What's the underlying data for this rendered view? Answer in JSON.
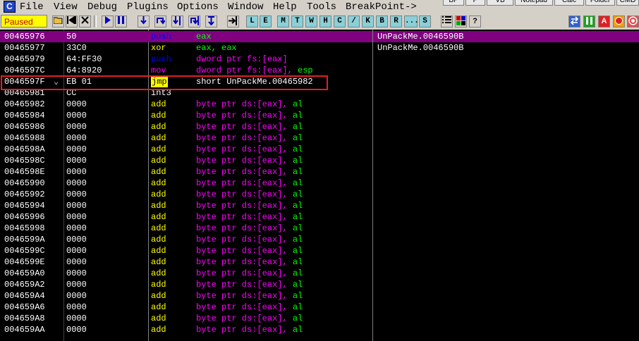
{
  "app": {
    "icon": "C"
  },
  "menu": [
    "File",
    "View",
    "Debug",
    "Plugins",
    "Options",
    "Window",
    "Help",
    "Tools",
    "BreakPoint->"
  ],
  "right_tabs": [
    "BP",
    "P",
    "VB",
    "Notepad",
    "Calc",
    "Folder",
    "CMD"
  ],
  "toolbar": {
    "status": "Paused",
    "letters": [
      "L",
      "E",
      "M",
      "T",
      "W",
      "H",
      "C",
      "/",
      "K",
      "B",
      "R",
      "...",
      "S"
    ]
  },
  "rows": [
    {
      "addr": "00465976",
      "bytes": "50",
      "mark": "",
      "mnem": "push",
      "ops": "eax"
    },
    {
      "addr": "00465977",
      "bytes": "33C0",
      "mark": "",
      "mnem": "xor",
      "ops": "eax, eax"
    },
    {
      "addr": "00465979",
      "bytes": "64:FF30",
      "mark": "",
      "mnem": "push",
      "ops": "dword ptr fs:[eax]"
    },
    {
      "addr": "0046597C",
      "bytes": "64:8920",
      "mark": "",
      "mnem": "mov",
      "ops": "dword ptr fs:[eax], esp"
    },
    {
      "addr": "0046597F",
      "bytes": "EB 01",
      "mark": "⌄",
      "mnem": "jmp",
      "ops": "short UnPackMe.00465982"
    },
    {
      "addr": "00465981",
      "bytes": "CC",
      "mark": "",
      "mnem": "int3",
      "ops": ""
    },
    {
      "addr": "00465982",
      "bytes": "0000",
      "mark": "",
      "mnem": "add",
      "ops": "byte ptr ds:[eax], al"
    },
    {
      "addr": "00465984",
      "bytes": "0000",
      "mark": "",
      "mnem": "add",
      "ops": "byte ptr ds:[eax], al"
    },
    {
      "addr": "00465986",
      "bytes": "0000",
      "mark": "",
      "mnem": "add",
      "ops": "byte ptr ds:[eax], al"
    },
    {
      "addr": "00465988",
      "bytes": "0000",
      "mark": "",
      "mnem": "add",
      "ops": "byte ptr ds:[eax], al"
    },
    {
      "addr": "0046598A",
      "bytes": "0000",
      "mark": "",
      "mnem": "add",
      "ops": "byte ptr ds:[eax], al"
    },
    {
      "addr": "0046598C",
      "bytes": "0000",
      "mark": "",
      "mnem": "add",
      "ops": "byte ptr ds:[eax], al"
    },
    {
      "addr": "0046598E",
      "bytes": "0000",
      "mark": "",
      "mnem": "add",
      "ops": "byte ptr ds:[eax], al"
    },
    {
      "addr": "00465990",
      "bytes": "0000",
      "mark": "",
      "mnem": "add",
      "ops": "byte ptr ds:[eax], al"
    },
    {
      "addr": "00465992",
      "bytes": "0000",
      "mark": "",
      "mnem": "add",
      "ops": "byte ptr ds:[eax], al"
    },
    {
      "addr": "00465994",
      "bytes": "0000",
      "mark": "",
      "mnem": "add",
      "ops": "byte ptr ds:[eax], al"
    },
    {
      "addr": "00465996",
      "bytes": "0000",
      "mark": "",
      "mnem": "add",
      "ops": "byte ptr ds:[eax], al"
    },
    {
      "addr": "00465998",
      "bytes": "0000",
      "mark": "",
      "mnem": "add",
      "ops": "byte ptr ds:[eax], al"
    },
    {
      "addr": "0046599A",
      "bytes": "0000",
      "mark": "",
      "mnem": "add",
      "ops": "byte ptr ds:[eax], al"
    },
    {
      "addr": "0046599C",
      "bytes": "0000",
      "mark": "",
      "mnem": "add",
      "ops": "byte ptr ds:[eax], al"
    },
    {
      "addr": "0046599E",
      "bytes": "0000",
      "mark": "",
      "mnem": "add",
      "ops": "byte ptr ds:[eax], al"
    },
    {
      "addr": "004659A0",
      "bytes": "0000",
      "mark": "",
      "mnem": "add",
      "ops": "byte ptr ds:[eax], al"
    },
    {
      "addr": "004659A2",
      "bytes": "0000",
      "mark": "",
      "mnem": "add",
      "ops": "byte ptr ds:[eax], al"
    },
    {
      "addr": "004659A4",
      "bytes": "0000",
      "mark": "",
      "mnem": "add",
      "ops": "byte ptr ds:[eax], al"
    },
    {
      "addr": "004659A6",
      "bytes": "0000",
      "mark": "",
      "mnem": "add",
      "ops": "byte ptr ds:[eax], al"
    },
    {
      "addr": "004659A8",
      "bytes": "0000",
      "mark": "",
      "mnem": "add",
      "ops": "byte ptr ds:[eax], al"
    },
    {
      "addr": "004659AA",
      "bytes": "0000",
      "mark": "",
      "mnem": "add",
      "ops": "byte ptr ds:[eax], al"
    }
  ],
  "comments": [
    "UnPackMe.0046590B",
    "UnPackMe.0046590B"
  ],
  "colors": {
    "selection": "#800080",
    "highlight_box": "#e02020",
    "status_bg": "#ffff00"
  }
}
